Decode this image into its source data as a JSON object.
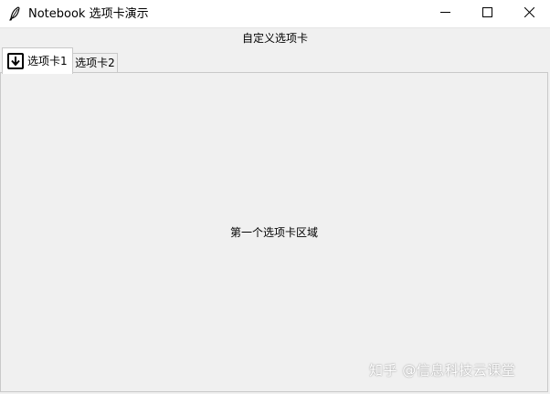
{
  "window": {
    "title": "Notebook 选项卡演示",
    "controls": {
      "minimize_icon": "minimize-icon",
      "maximize_icon": "maximize-icon",
      "close_icon": "close-icon"
    }
  },
  "header": {
    "label": "自定义选项卡"
  },
  "tabs": [
    {
      "label": "选项卡1",
      "icon": "download-icon",
      "selected": true
    },
    {
      "label": "选项卡2",
      "selected": false
    }
  ],
  "panel": {
    "text": "第一个选项卡区域"
  },
  "watermark": {
    "text": "知乎 @信息科技云课堂"
  },
  "colors": {
    "titlebar_bg": "#ffffff",
    "window_bg": "#f0f0f0",
    "tab_border": "#c9c9c9"
  }
}
